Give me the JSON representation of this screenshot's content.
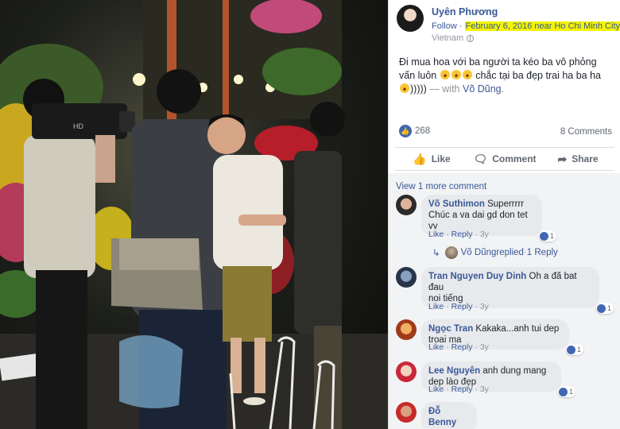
{
  "post": {
    "author": "Uyên Phương",
    "follow": "Follow",
    "separator": " · ",
    "date_location": "February 6, 2016 near Ho Chi Minh City.",
    "country": "Vietnam",
    "text_part1": "Đi mua hoa với ba người ta kéo ba vô phỏng vấn luôn",
    "text_part2": " chắc tại ba đẹp trai ha ba ha ",
    "text_part3": ")))))",
    "with_label": " — with ",
    "with_name": "Võ Dũng",
    "with_end": "."
  },
  "stats": {
    "likes": "268",
    "comments": "8 Comments"
  },
  "actions": {
    "like": "Like",
    "comment": "Comment",
    "share": "Share"
  },
  "comments_section": {
    "view_more": "View 1 more comment",
    "like_label": "Like",
    "reply_label": "Reply",
    "dot": "·",
    "items": [
      {
        "name": "Võ Suthimon",
        "text": " Superrrrr",
        "text2": "Chúc a va dai gd don tet vv",
        "reactions": "1",
        "age": "3y"
      },
      {
        "name": "Tran Nguyen Duy Dinh",
        "text": " Oh a đã bat đau",
        "text2": "noi tiếng",
        "reactions": "1",
        "age": "3y"
      },
      {
        "name": "Ngọc Tran",
        "text": " Kakaka...anh tui dep troai ma",
        "text2": "",
        "reactions": "1",
        "age": "3y"
      },
      {
        "name": "Lee Nguyên",
        "text": " anh dung mang dep lào đẹp",
        "text2": "",
        "reactions": "1",
        "age": "3y"
      },
      {
        "name": "Đỗ Benny",
        "text": "",
        "text2": "",
        "reactions": "",
        "age": ""
      }
    ],
    "reply_thread": {
      "name": "Võ Dũng",
      "verb": " replied",
      "sep": " · ",
      "count": "1 Reply"
    }
  },
  "icons": {
    "like": "thumbs-up-icon",
    "comment": "speech-bubble-icon",
    "share": "share-arrow-icon",
    "globe": "globe-icon"
  },
  "colors": {
    "link": "#385898",
    "highlight": "#f5f500",
    "like_badge": "#4267b2"
  }
}
